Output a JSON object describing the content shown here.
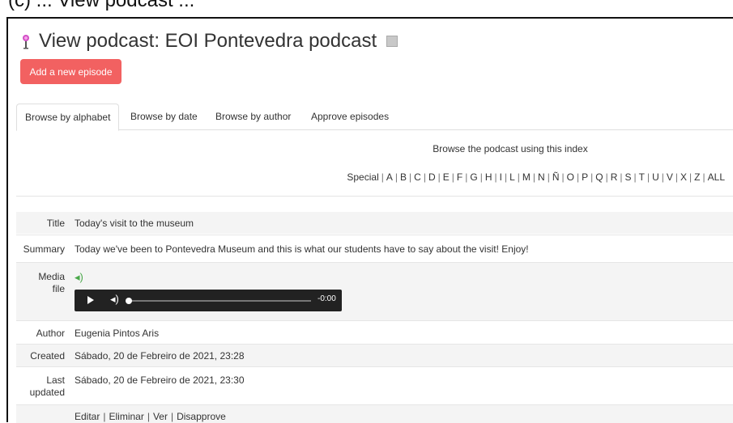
{
  "frame_caption": "(c) ... View podcast ...",
  "page": {
    "title": "View podcast: EOI Pontevedra podcast",
    "add_episode_label": "Add a new episode"
  },
  "tabs": [
    {
      "label": "Browse by alphabet",
      "active": true
    },
    {
      "label": "Browse by date",
      "active": false
    },
    {
      "label": "Browse by author",
      "active": false
    },
    {
      "label": "Approve episodes",
      "active": false
    }
  ],
  "browse": {
    "hint": "Browse the podcast using this index",
    "letters": [
      "Special",
      "A",
      "B",
      "C",
      "D",
      "E",
      "F",
      "G",
      "H",
      "I",
      "L",
      "M",
      "N",
      "Ñ",
      "O",
      "P",
      "Q",
      "R",
      "S",
      "T",
      "U",
      "V",
      "X",
      "Z",
      "ALL"
    ]
  },
  "entry": {
    "title_label": "Title",
    "title_value": "Today's visit to the museum",
    "summary_label": "Summary",
    "summary_value": "Today we've been to Pontevedra Museum and this is what our students have to say about the visit! Enjoy!",
    "media_label_1": "Media",
    "media_label_2": "file",
    "player_time": "-0:00",
    "author_label": "Author",
    "author_value": "Eugenia Pintos Aris",
    "created_label": "Created",
    "created_value": "Sábado, 20 de Febreiro de 2021, 23:28",
    "updated_label_1": "Last",
    "updated_label_2": "updated",
    "updated_value": "Sábado, 20 de Febreiro de 2021, 23:30",
    "actions": [
      "Editar",
      "Eliminar",
      "Ver",
      "Disapprove"
    ]
  },
  "colors": {
    "accent_button": "#f26161",
    "media_icon": "#4aa84a",
    "player_bg": "#222222"
  },
  "icons": {
    "title": "podcast-microphone-icon",
    "help": "help-icon",
    "media": "speaker-icon"
  }
}
